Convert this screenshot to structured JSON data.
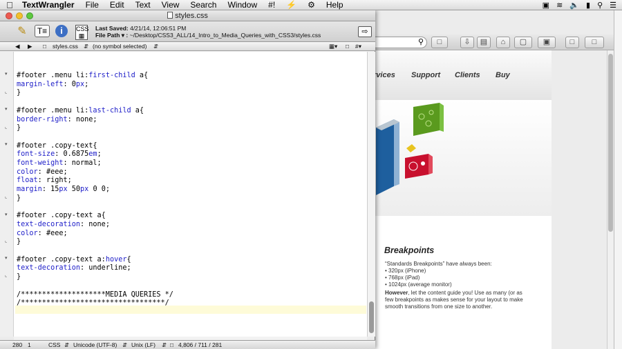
{
  "menubar": {
    "app_name": "TextWrangler",
    "items": [
      "File",
      "Edit",
      "Text",
      "View",
      "Search",
      "Window",
      "#!"
    ]
  },
  "menubar_help": "Help",
  "window": {
    "title": "styles.css"
  },
  "file_info": {
    "saved_label": "Last Saved:",
    "saved_value": "4/21/14, 12:06:51 PM",
    "path_label": "File Path ▾ :",
    "path_value": "~/Desktop/CSS3_ALL/14_Intro_to_Media_Queries_with_CSS3/styles.css"
  },
  "nav": {
    "file_name": "styles.css",
    "symbol": "(no symbol selected)"
  },
  "code_lines": [
    "#footer .menu li:first-child a{",
    "margin-left: 0px;",
    "}",
    "",
    "#footer .menu li:last-child a{",
    "border-right: none;",
    "}",
    "",
    "#footer .copy-text{",
    "font-size: 0.6875em;",
    "font-weight: normal;",
    "color: #eee;",
    "float: right;",
    "margin: 15px 50px 0 0;",
    "}",
    "",
    "#footer .copy-text a{",
    "text-decoration: none;",
    "color: #eee;",
    "}",
    "",
    "#footer .copy-text a:hover{",
    "text-decoration: underline;",
    "}",
    "",
    "/********************MEDIA QUERIES */",
    "/**********************************/"
  ],
  "status": {
    "line": "280",
    "col": "1",
    "language": "CSS",
    "encoding": "Unicode (UTF-8)",
    "line_endings": "Unix (LF)",
    "counts": "4,806 / 711 / 281"
  },
  "webpage": {
    "nav": [
      "rvices",
      "Support",
      "Clients",
      "Buy"
    ],
    "breakpoints_title": "Breakpoints",
    "intro": "“Standards Breakpoints” have always been:",
    "list": [
      "• 320px (iPhone)",
      "• 768px (iPad)",
      "• 1024px (average monitor)"
    ],
    "however_bold": "However",
    "however_rest": ", let the content guide you! Use as many (or as few breakpoints as makes sense for your layout to make smooth transitions from one size to another."
  },
  "colors": {
    "keyword": "#1c1cc8",
    "current_line": "#fefbd8"
  }
}
